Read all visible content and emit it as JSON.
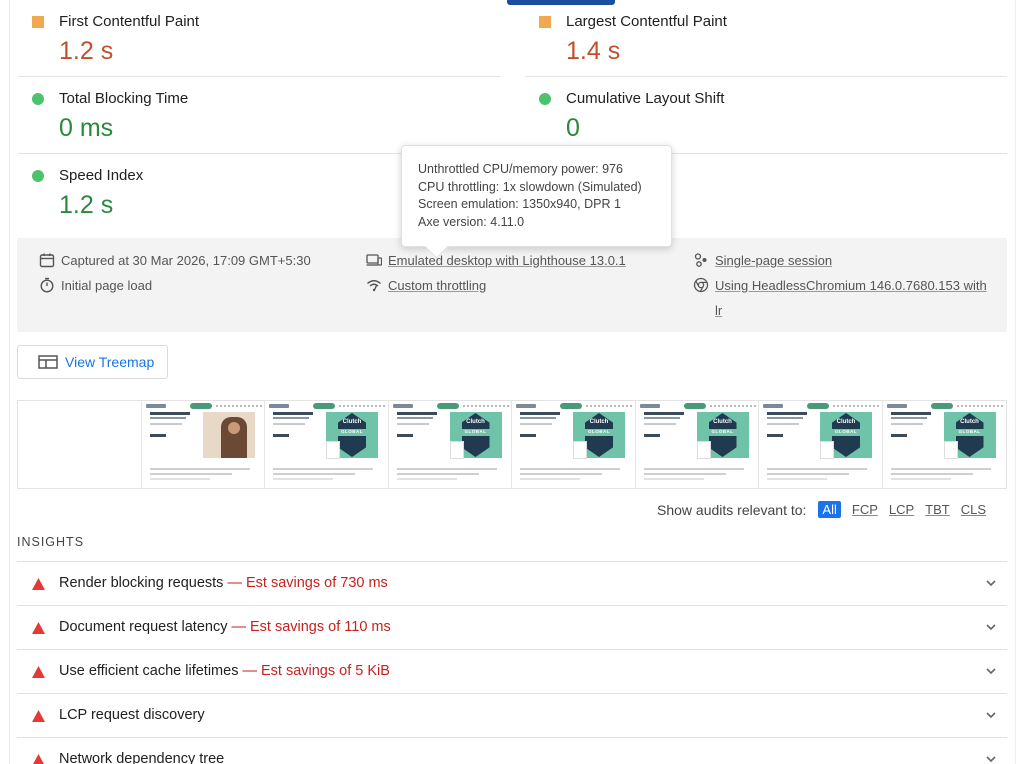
{
  "metrics": [
    {
      "name": "first-contentful-paint",
      "title": "First Contentful Paint",
      "value": "1.2 s",
      "status": "average"
    },
    {
      "name": "largest-contentful-paint",
      "title": "Largest Contentful Paint",
      "value": "1.4 s",
      "status": "average"
    },
    {
      "name": "total-blocking-time",
      "title": "Total Blocking Time",
      "value": "0 ms",
      "status": "pass"
    },
    {
      "name": "cumulative-layout-shift",
      "title": "Cumulative Layout Shift",
      "value": "0",
      "status": "pass"
    },
    {
      "name": "speed-index",
      "title": "Speed Index",
      "value": "1.2 s",
      "status": "pass"
    }
  ],
  "tooltip": {
    "line1": "Unthrottled CPU/memory power: 976",
    "line2": "CPU throttling: 1x slowdown (Simulated)",
    "line3": "Screen emulation: 1350x940, DPR 1",
    "line4": "Axe version: 4.11.0"
  },
  "info": {
    "captured": "Captured at 30 Mar 2026, 17:09 GMT+5:30",
    "page_load": "Initial page load",
    "emulated": "Emulated desktop with Lighthouse 13.0.1",
    "throttling": "Custom throttling",
    "session": "Single-page session",
    "browser": "Using HeadlessChromium 146.0.7680.153 with lr"
  },
  "treemap_label": "View Treemap",
  "filmstrip": {
    "badge_text": "Clutch",
    "badge_band": "GLOBAL"
  },
  "audit_filter": {
    "label": "Show audits relevant to:",
    "chips": [
      "All",
      "FCP",
      "LCP",
      "TBT",
      "CLS"
    ]
  },
  "insights": {
    "section_title": "INSIGHTS",
    "items": [
      {
        "title": "Render blocking requests",
        "savings": "— Est savings of 730 ms"
      },
      {
        "title": "Document request latency",
        "savings": "— Est savings of 110 ms"
      },
      {
        "title": "Use efficient cache lifetimes",
        "savings": "— Est savings of 5 KiB"
      },
      {
        "title": "LCP request discovery",
        "savings": ""
      },
      {
        "title": "Network dependency tree",
        "savings": ""
      }
    ]
  },
  "colors": {
    "average": "#f0a950",
    "pass": "#4ec16b",
    "fail": "#e53935",
    "link": "#1a73e8"
  }
}
